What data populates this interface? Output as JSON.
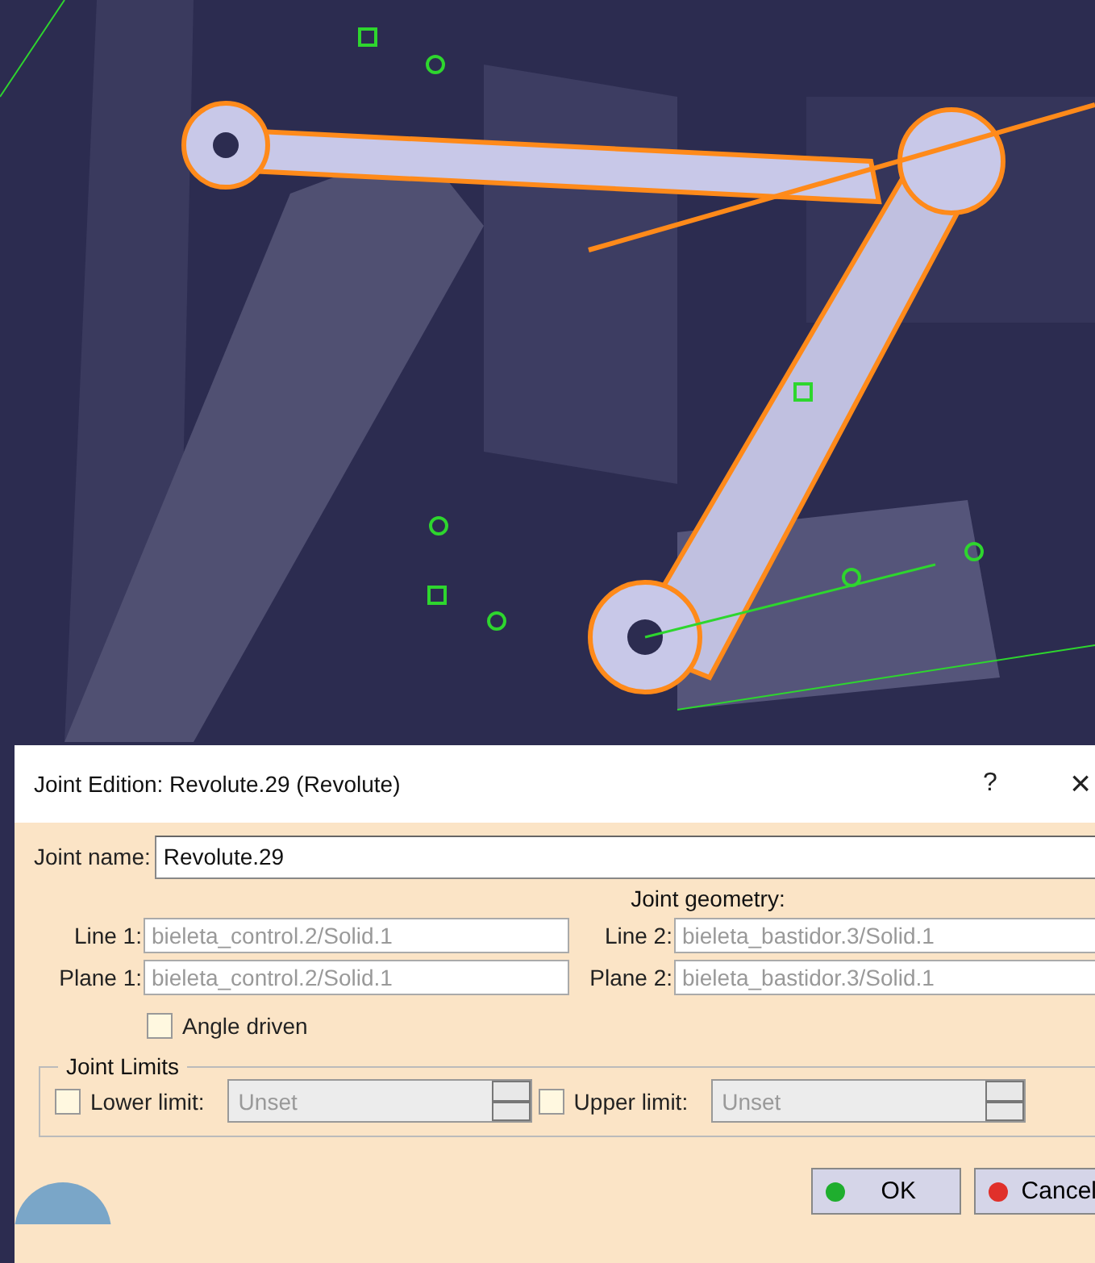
{
  "dialog": {
    "title": "Joint Edition: Revolute.29 (Revolute)",
    "help": "?",
    "close": "×"
  },
  "joint_name": {
    "label": "Joint name:",
    "value": "Revolute.29"
  },
  "geometry": {
    "heading": "Joint geometry:",
    "fields": [
      {
        "label": "Line 1:",
        "value": "bieleta_control.2/Solid.1",
        "disabled": true
      },
      {
        "label": "Line 2:",
        "value": "bieleta_bastidor.3/Solid.1",
        "disabled": true
      },
      {
        "label": "Plane 1:",
        "value": "bieleta_control.2/Solid.1",
        "disabled": true
      },
      {
        "label": "Plane 2:",
        "value": "bieleta_bastidor.3/Solid.1",
        "disabled": true
      }
    ]
  },
  "angle_driven": {
    "label": "Angle driven",
    "checked": false
  },
  "limits": {
    "legend": "Joint Limits",
    "items": [
      {
        "label": "Lower limit:",
        "checked": false,
        "value": "Unset",
        "disabled": true
      },
      {
        "label": "Upper limit:",
        "checked": false,
        "value": "Unset",
        "disabled": true
      }
    ]
  },
  "buttons": [
    {
      "label": "OK",
      "kind": "ok"
    },
    {
      "label": "Cancel",
      "kind": "cancel"
    }
  ]
}
